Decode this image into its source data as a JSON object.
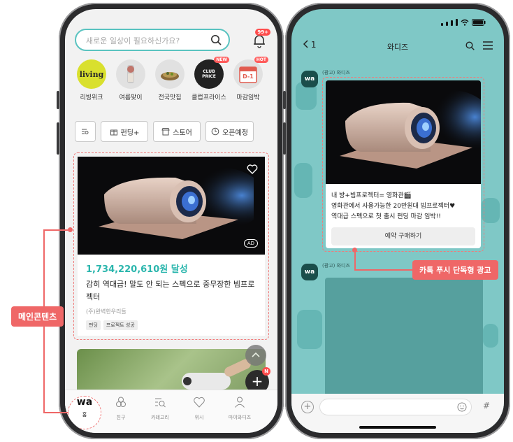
{
  "left": {
    "search": {
      "placeholder": "새로운 일상이 필요하신가요?"
    },
    "notification_badge": "99+",
    "categories": [
      {
        "label": "리빙위크",
        "icon_text": "living",
        "tag": ""
      },
      {
        "label": "여름맞이",
        "icon_text": "",
        "tag": ""
      },
      {
        "label": "전국맛집",
        "icon_text": "",
        "tag": ""
      },
      {
        "label": "클럽프라이스",
        "icon_text": "CLUB PRICE",
        "tag": "NEW"
      },
      {
        "label": "마감임박",
        "icon_text": "D-1",
        "tag": "HOT"
      }
    ],
    "filters": [
      {
        "label": "",
        "icon": "filter-search-icon"
      },
      {
        "label": "펀딩+",
        "icon": "gift-icon"
      },
      {
        "label": "스토어",
        "icon": "store-icon"
      },
      {
        "label": "오픈예정",
        "icon": "clock-icon"
      }
    ],
    "card": {
      "ad": "AD",
      "amount": "1,734,220,610원 달성",
      "title": "감히 역대급! 말도 안 되는 스펙으로 중무장한 빔프로젝터",
      "maker": "(주)완벽한우리들",
      "chips": [
        "펀딩",
        "프로젝트 성공"
      ]
    },
    "fab_badge": "N",
    "fab_plus": "+",
    "tabs": [
      {
        "label": "홈",
        "icon": "wa"
      },
      {
        "label": "친구",
        "icon": "friends-icon"
      },
      {
        "label": "카테고리",
        "icon": "category-icon"
      },
      {
        "label": "위시",
        "icon": "heart-icon"
      },
      {
        "label": "마이와디즈",
        "icon": "person-icon"
      }
    ]
  },
  "right": {
    "back_label": "1",
    "chat_title": "와디즈",
    "sender_avatar": "wa",
    "sender_name": "(광고) 와디즈",
    "message_lines": [
      "내 방+빔프로젝터= 영화관🎬",
      "영화관에서 사용가능한 20만원대 빔프로젝터♥",
      "역대급 스펙으로 첫 출시 펀딩 마감 임박!!"
    ],
    "message_button": "예약 구매하기",
    "sender2_name": "(광고) 와디즈",
    "input_hash": "#"
  },
  "callouts": {
    "main_content": "메인콘텐츠",
    "push_ad": "카톡 푸시 단독형 광고"
  },
  "colors": {
    "accent": "#59c3c0",
    "highlight": "#ef6767",
    "amount": "#2bb6ad",
    "chat_bg": "#7fc8c6"
  }
}
